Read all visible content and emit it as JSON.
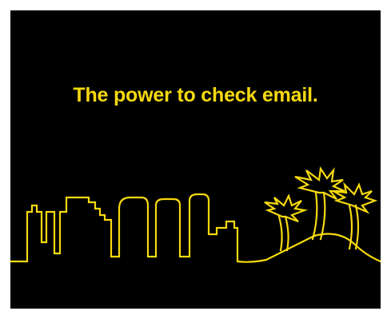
{
  "ad": {
    "headline": "The power to check email.",
    "accent_color": "#f6d90f",
    "background_color": "#000000",
    "illustration": "city-skyline-with-palm-trees-outline"
  }
}
